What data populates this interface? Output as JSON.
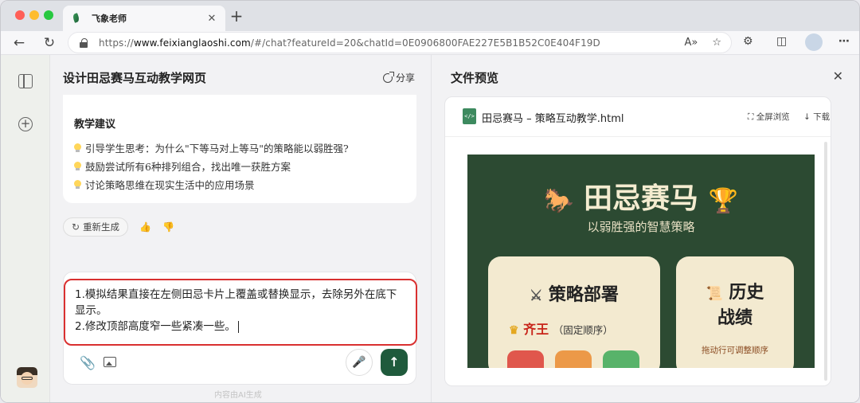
{
  "browser": {
    "tab_title": "飞象老师",
    "tab_close": "✕",
    "new_tab": "+",
    "url_prefix": "https://",
    "url_host": "www.feixianglaoshi.com",
    "url_path": "/#/chat?featureId=20&chatId=0E0906800FAE227E5B1B52C0E404F19D",
    "read_aloud_icon": "A»",
    "favorite_icon": "☆",
    "extensions_icon": "⚙",
    "split_icon": "◫",
    "more_icon": "⋯",
    "back_icon": "←",
    "refresh_icon": "↻"
  },
  "rail": {
    "new_chat_icon": "+"
  },
  "chat": {
    "title": "设计田忌赛马互动教学网页",
    "share_label": "分享",
    "message": {
      "heading": "教学建议",
      "tips": [
        "引导学生思考：为什么\"下等马对上等马\"的策略能以弱胜强?",
        "鼓励尝试所有6种排列组合，找出唯一获胜方案",
        "讨论策略思维在现实生活中的应用场景"
      ]
    },
    "regenerate_label": "重新生成",
    "regenerate_icon": "↻",
    "like_icon": "👍",
    "dislike_icon": "👎",
    "composer": {
      "lines": [
        "1.模拟结果直接在左侧田忌卡片上覆盖或替换显示，去除另外在底下",
        "显示。",
        "2.修改顶部高度窄一些紧凑一些。"
      ],
      "attach_icon": "📎",
      "mic_icon": "🎤",
      "send_icon": "↑"
    },
    "disclaimer": "内容由AI生成"
  },
  "preview": {
    "title": "文件预览",
    "close_icon": "✕",
    "file_icon": "</>",
    "file_name": "田忌赛马 – 策略互动教学.html",
    "fullscreen_label": "⛶ 全屏浏览",
    "download_label": "↓ 下载",
    "page": {
      "hero_title": "田忌赛马",
      "horse_icon": "🐎",
      "trophy_icon": "🏆",
      "hero_subtitle": "以弱胜强的智慧策略",
      "strategy_icon": "⚔",
      "strategy_title": "策略部署",
      "crown_icon": "♛",
      "king_name": "齐王",
      "king_note": "（固定顺序）",
      "history_icon": "📜",
      "history_title_1": "历史",
      "history_title_2": "战绩",
      "history_note": "拖动行可调整顺序"
    }
  },
  "colors": {
    "send_button": "#1f5a3c",
    "highlight_border": "#d93030",
    "preview_bg": "#2c4a32",
    "card_bg": "#f3ead0",
    "king_text": "#c8251a"
  }
}
